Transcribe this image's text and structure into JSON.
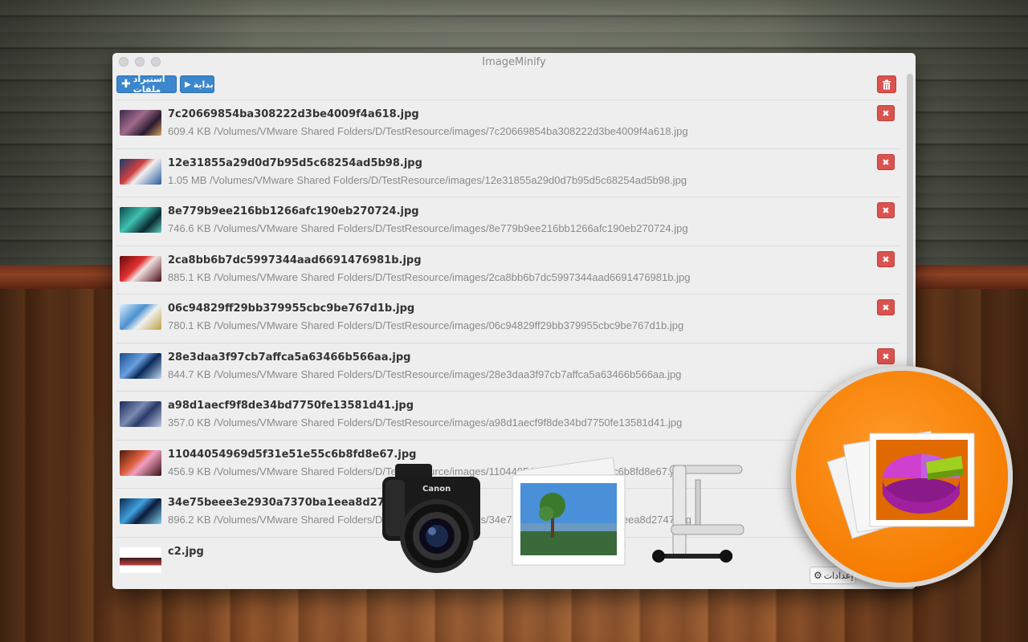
{
  "window": {
    "title": "ImageMinify"
  },
  "toolbar": {
    "import_label": "استيراد ملفات",
    "start_label": "بداية"
  },
  "files": [
    {
      "name": "7c20669854ba308222d3be4009f4a618.jpg",
      "meta": "609.4 KB /Volumes/VMware Shared Folders/D/TestResource/images/7c20669854ba308222d3be4009f4a618.jpg"
    },
    {
      "name": "12e31855a29d0d7b95d5c68254ad5b98.jpg",
      "meta": "1.05 MB /Volumes/VMware Shared Folders/D/TestResource/images/12e31855a29d0d7b95d5c68254ad5b98.jpg"
    },
    {
      "name": "8e779b9ee216bb1266afc190eb270724.jpg",
      "meta": "746.6 KB /Volumes/VMware Shared Folders/D/TestResource/images/8e779b9ee216bb1266afc190eb270724.jpg"
    },
    {
      "name": "2ca8bb6b7dc5997344aad6691476981b.jpg",
      "meta": "885.1 KB /Volumes/VMware Shared Folders/D/TestResource/images/2ca8bb6b7dc5997344aad6691476981b.jpg"
    },
    {
      "name": "06c94829ff29bb379955cbc9be767d1b.jpg",
      "meta": "780.1 KB /Volumes/VMware Shared Folders/D/TestResource/images/06c94829ff29bb379955cbc9be767d1b.jpg"
    },
    {
      "name": "28e3daa3f97cb7affca5a63466b566aa.jpg",
      "meta": "844.7 KB /Volumes/VMware Shared Folders/D/TestResource/images/28e3daa3f97cb7affca5a63466b566aa.jpg"
    },
    {
      "name": "a98d1aecf9f8de34bd7750fe13581d41.jpg",
      "meta": "357.0 KB /Volumes/VMware Shared Folders/D/TestResource/images/a98d1aecf9f8de34bd7750fe13581d41.jpg"
    },
    {
      "name": "11044054969d5f31e51e55c6b8fd8e67.jpg",
      "meta": "456.9 KB /Volumes/VMware Shared Folders/D/TestResource/images/11044054969d5f31e51e55c6b8fd8e67.jpg"
    },
    {
      "name": "34e75beee3e2930a7370ba1eea8d2747.jpg",
      "meta": "896.2 KB /Volumes/VMware Shared Folders/D/TestResource/images/34e75beee3e2930a7370ba1eea8d2747.jpg"
    },
    {
      "name": "c2.jpg",
      "meta": ""
    }
  ],
  "footer": {
    "settings_label": "إعدادات"
  },
  "promo": {
    "camera_brand": "Canon"
  },
  "colors": {
    "primary_button": "#3b86cc",
    "danger_button": "#d9534f",
    "badge": "#f57c00"
  },
  "icons": [
    "plus-icon",
    "play-icon",
    "trash-icon",
    "close-icon",
    "gear-icon"
  ]
}
